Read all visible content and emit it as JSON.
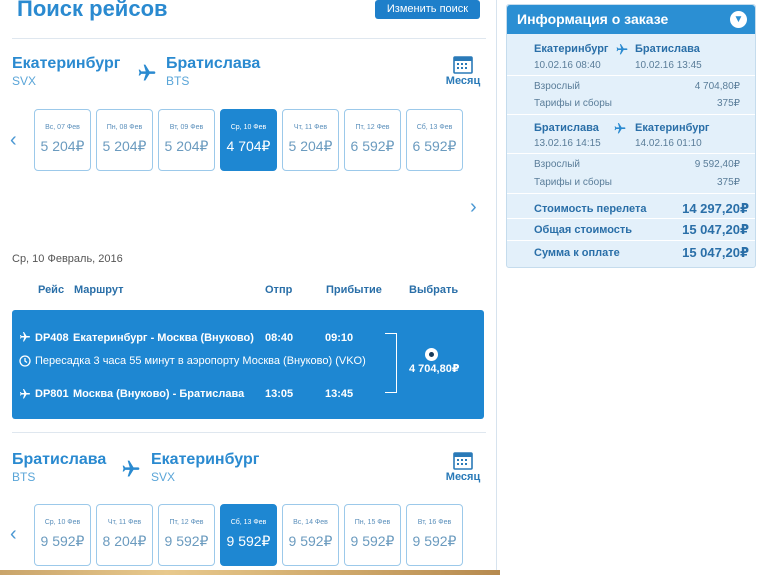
{
  "header": {
    "title": "Поиск рейсов",
    "change_search": "Изменить поиск"
  },
  "outbound": {
    "from_city": "Екатеринбург",
    "from_code": "SVX",
    "to_city": "Братислава",
    "to_code": "BTS",
    "month_label": "Месяц",
    "days": [
      {
        "label": "Вс, 07 Фев",
        "price": "5 204₽"
      },
      {
        "label": "Пн, 08 Фев",
        "price": "5 204₽"
      },
      {
        "label": "Вт, 09 Фев",
        "price": "5 204₽"
      },
      {
        "label": "Ср, 10 Фев",
        "price": "4 704₽"
      },
      {
        "label": "Чт, 11 Фев",
        "price": "5 204₽"
      },
      {
        "label": "Пт, 12 Фев",
        "price": "6 592₽"
      },
      {
        "label": "Сб, 13 Фев",
        "price": "6 592₽"
      }
    ]
  },
  "selected_date": "Ср, 10 Февраль, 2016",
  "table_headers": {
    "flight": "Рейс",
    "route": "Маршрут",
    "depart": "Отпр",
    "arrive": "Прибытие",
    "select": "Выбрать"
  },
  "flight": {
    "seg1_num": "DP408",
    "seg1_route": "Екатеринбург - Москва (Внуково)",
    "seg1_dep": "08:40",
    "seg1_arr": "09:10",
    "transfer": "Пересадка 3 часа 55 минут в аэропорту Москва (Внуково) (VKO)",
    "seg2_num": "DP801",
    "seg2_route": "Москва (Внуково) - Братислава",
    "seg2_dep": "13:05",
    "seg2_arr": "13:45",
    "price": "4 704,80₽"
  },
  "inbound": {
    "from_city": "Братислава",
    "from_code": "BTS",
    "to_city": "Екатеринбург",
    "to_code": "SVX",
    "month_label": "Месяц",
    "days": [
      {
        "label": "Ср, 10 Фев",
        "price": "9 592₽"
      },
      {
        "label": "Чт, 11 Фев",
        "price": "8 204₽"
      },
      {
        "label": "Пт, 12 Фев",
        "price": "9 592₽"
      },
      {
        "label": "Сб, 13 Фев",
        "price": "9 592₽"
      },
      {
        "label": "Вс, 14 Фев",
        "price": "9 592₽"
      },
      {
        "label": "Пн, 15 Фев",
        "price": "9 592₽"
      },
      {
        "label": "Вт, 16 Фев",
        "price": "9 592₽"
      }
    ]
  },
  "order": {
    "title": "Информация о заказе",
    "leg1": {
      "from": "Екатеринбург",
      "to": "Братислава",
      "dep": "10.02.16 08:40",
      "arr": "10.02.16 13:45",
      "adult_label": "Взрослый",
      "adult_value": "4 704,80₽",
      "fees_label": "Тарифы и сборы",
      "fees_value": "375₽"
    },
    "leg2": {
      "from": "Братислава",
      "to": "Екатеринбург",
      "dep": "13.02.16 14:15",
      "arr": "14.02.16 01:10",
      "adult_label": "Взрослый",
      "adult_value": "9 592,40₽",
      "fees_label": "Тарифы и сборы",
      "fees_value": "375₽"
    },
    "flight_cost_label": "Стоимость перелета",
    "flight_cost_value": "14 297,20₽",
    "total_label": "Общая стоимость",
    "total_value": "15 047,20₽",
    "pay_label": "Сумма к оплате",
    "pay_value": "15 047,20₽"
  },
  "colors": {
    "accent": "#1e87d2",
    "panel": "#e3f0fa"
  },
  "active_outbound_index": 3,
  "active_inbound_index": 3
}
